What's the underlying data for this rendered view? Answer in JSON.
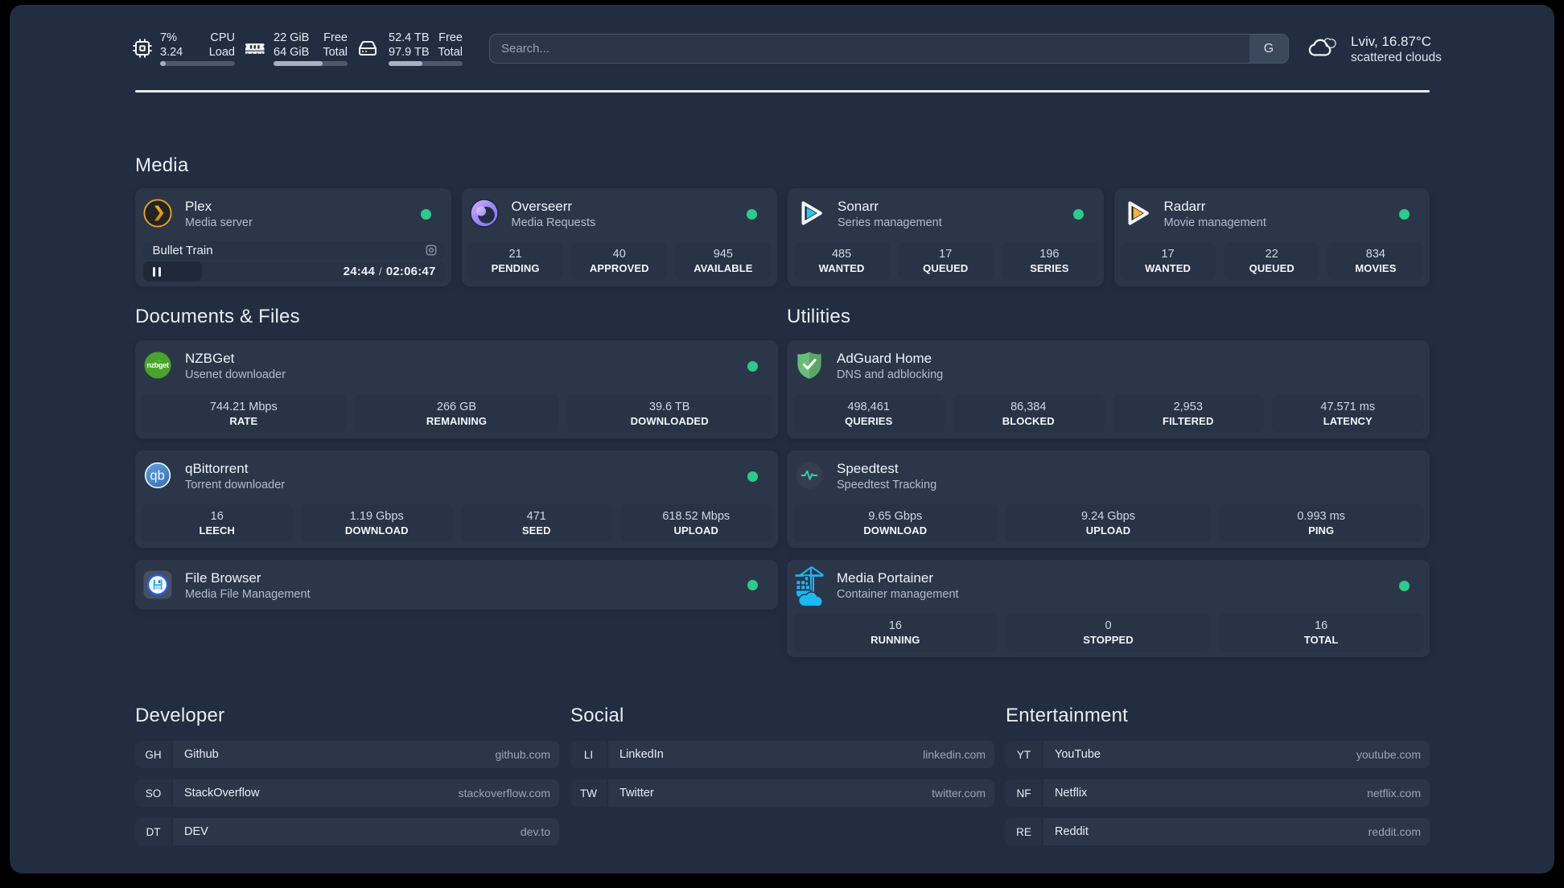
{
  "topbar": {
    "cpu": {
      "line1_left": "7%",
      "line1_right": "CPU",
      "line2_left": "3.24",
      "line2_right": "Load",
      "percent": 7
    },
    "memory": {
      "line1_left": "22 GiB",
      "line1_right": "Free",
      "line2_left": "64 GiB",
      "line2_right": "Total",
      "percent": 66
    },
    "disk": {
      "line1_left": "52.4 TB",
      "line1_right": "Free",
      "line2_left": "97.9 TB",
      "line2_right": "Total",
      "percent": 46
    },
    "search": {
      "placeholder": "Search...",
      "button_label": "G"
    },
    "weather": {
      "location": "Lviv, 16.87°C",
      "condition": "scattered clouds"
    }
  },
  "media": {
    "title": "Media",
    "plex": {
      "name": "Plex",
      "desc": "Media server",
      "now_playing": "Bullet Train",
      "position": "24:44",
      "time_separator": "/",
      "duration": "02:06:47",
      "progress_percent": 19.5
    },
    "overseerr": {
      "name": "Overseerr",
      "desc": "Media Requests",
      "stats": [
        {
          "value": "21",
          "label": "PENDING"
        },
        {
          "value": "40",
          "label": "APPROVED"
        },
        {
          "value": "945",
          "label": "AVAILABLE"
        }
      ]
    },
    "sonarr": {
      "name": "Sonarr",
      "desc": "Series management",
      "stats": [
        {
          "value": "485",
          "label": "WANTED"
        },
        {
          "value": "17",
          "label": "QUEUED"
        },
        {
          "value": "196",
          "label": "SERIES"
        }
      ]
    },
    "radarr": {
      "name": "Radarr",
      "desc": "Movie management",
      "stats": [
        {
          "value": "17",
          "label": "WANTED"
        },
        {
          "value": "22",
          "label": "QUEUED"
        },
        {
          "value": "834",
          "label": "MOVIES"
        }
      ]
    }
  },
  "documents": {
    "title": "Documents & Files",
    "nzbget": {
      "name": "NZBGet",
      "desc": "Usenet downloader",
      "stats": [
        {
          "value": "744.21 Mbps",
          "label": "RATE"
        },
        {
          "value": "266 GB",
          "label": "REMAINING"
        },
        {
          "value": "39.6 TB",
          "label": "DOWNLOADED"
        }
      ]
    },
    "qbittorrent": {
      "name": "qBittorrent",
      "desc": "Torrent downloader",
      "stats": [
        {
          "value": "16",
          "label": "LEECH"
        },
        {
          "value": "1.19 Gbps",
          "label": "DOWNLOAD"
        },
        {
          "value": "471",
          "label": "SEED"
        },
        {
          "value": "618.52 Mbps",
          "label": "UPLOAD"
        }
      ]
    },
    "filebrowser": {
      "name": "File Browser",
      "desc": "Media File Management"
    }
  },
  "utilities": {
    "title": "Utilities",
    "adguard": {
      "name": "AdGuard Home",
      "desc": "DNS and adblocking",
      "stats": [
        {
          "value": "498,461",
          "label": "QUERIES"
        },
        {
          "value": "86,384",
          "label": "BLOCKED"
        },
        {
          "value": "2,953",
          "label": "FILTERED"
        },
        {
          "value": "47.571 ms",
          "label": "LATENCY"
        }
      ]
    },
    "speedtest": {
      "name": "Speedtest",
      "desc": "Speedtest Tracking",
      "stats": [
        {
          "value": "9.65 Gbps",
          "label": "DOWNLOAD"
        },
        {
          "value": "9.24 Gbps",
          "label": "UPLOAD"
        },
        {
          "value": "0.993 ms",
          "label": "PING"
        }
      ]
    },
    "portainer": {
      "name": "Media Portainer",
      "desc": "Container management",
      "stats": [
        {
          "value": "16",
          "label": "RUNNING"
        },
        {
          "value": "0",
          "label": "STOPPED"
        },
        {
          "value": "16",
          "label": "TOTAL"
        }
      ]
    }
  },
  "bookmarks": {
    "developer": {
      "title": "Developer",
      "items": [
        {
          "abbr": "GH",
          "name": "Github",
          "url": "github.com"
        },
        {
          "abbr": "SO",
          "name": "StackOverflow",
          "url": "stackoverflow.com"
        },
        {
          "abbr": "DT",
          "name": "DEV",
          "url": "dev.to"
        }
      ]
    },
    "social": {
      "title": "Social",
      "items": [
        {
          "abbr": "LI",
          "name": "LinkedIn",
          "url": "linkedin.com"
        },
        {
          "abbr": "TW",
          "name": "Twitter",
          "url": "twitter.com"
        }
      ]
    },
    "entertainment": {
      "title": "Entertainment",
      "items": [
        {
          "abbr": "YT",
          "name": "YouTube",
          "url": "youtube.com"
        },
        {
          "abbr": "NF",
          "name": "Netflix",
          "url": "netflix.com"
        },
        {
          "abbr": "RE",
          "name": "Reddit",
          "url": "reddit.com"
        }
      ]
    }
  }
}
